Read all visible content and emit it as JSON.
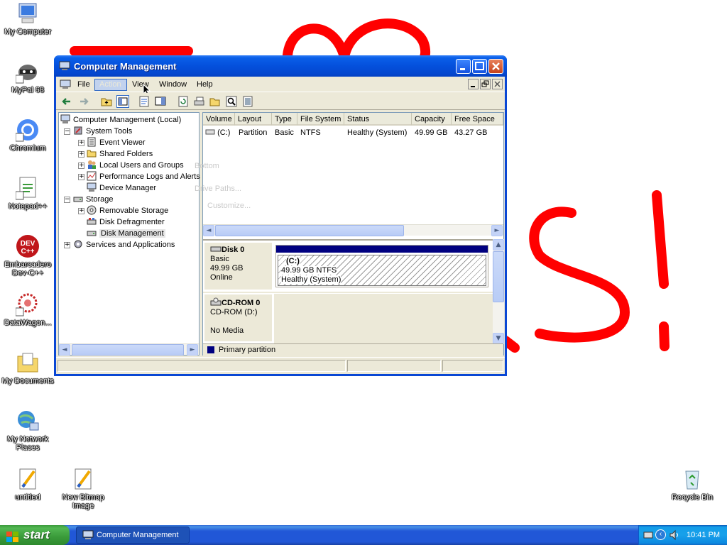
{
  "desktop": {
    "icons": [
      {
        "label": "My Computer",
        "icon": "my-computer-icon"
      },
      {
        "label": "MyPal 68",
        "icon": "mypal-raccoon-icon"
      },
      {
        "label": "Chromium",
        "icon": "chromium-icon"
      },
      {
        "label": "Notepad++",
        "icon": "notepad-plus-plus-icon"
      },
      {
        "label": "Embarcadero Dev-C++",
        "icon": "dev-cpp-icon"
      },
      {
        "label": "DataWagon...",
        "icon": "datawagon-icon"
      },
      {
        "label": "My Documents",
        "icon": "my-documents-icon"
      },
      {
        "label": "My Network Places",
        "icon": "network-places-icon"
      },
      {
        "label": "untitled",
        "icon": "paint-bitmap-icon"
      },
      {
        "label": "New Bitmap Image",
        "icon": "paint-bitmap-icon"
      },
      {
        "label": "Recycle Bin",
        "icon": "recycle-bin-icon"
      }
    ],
    "wallpaper_color": "#ff0000"
  },
  "window": {
    "title": "Computer Management",
    "menu": {
      "file": "File",
      "action": "Action",
      "view": "View",
      "window": "Window",
      "help": "Help"
    },
    "ghost_menu": [
      "Bottom",
      "Drive Paths...",
      "Customize..."
    ]
  },
  "tree": {
    "root": "Computer Management (Local)",
    "system_tools": "System Tools",
    "event_viewer": "Event Viewer",
    "shared_folders": "Shared Folders",
    "local_users": "Local Users and Groups",
    "perf_logs": "Performance Logs and Alerts",
    "device_manager": "Device Manager",
    "storage": "Storage",
    "removable": "Removable Storage",
    "defrag": "Disk Defragmenter",
    "disk_mgmt": "Disk Management",
    "services": "Services and Applications"
  },
  "volumes": {
    "columns": [
      "Volume",
      "Layout",
      "Type",
      "File System",
      "Status",
      "Capacity",
      "Free Space"
    ],
    "rows": [
      {
        "volume": "(C:)",
        "layout": "Partition",
        "type": "Basic",
        "fs": "NTFS",
        "status": "Healthy (System)",
        "capacity": "49.99 GB",
        "free": "43.27 GB"
      }
    ]
  },
  "disks": {
    "disk0": {
      "name": "Disk 0",
      "type": "Basic",
      "size": "49.99 GB",
      "state": "Online",
      "partition": {
        "label": "(C:)",
        "info": "49.99 GB NTFS",
        "status": "Healthy (System)"
      }
    },
    "cdrom0": {
      "name": "CD-ROM 0",
      "type": "CD-ROM (D:)",
      "media": "No Media"
    }
  },
  "legend": {
    "primary": "Primary partition",
    "primary_color": "#000080"
  },
  "taskbar": {
    "start": "start",
    "task": "Computer Management",
    "clock": "10:41 PM"
  }
}
